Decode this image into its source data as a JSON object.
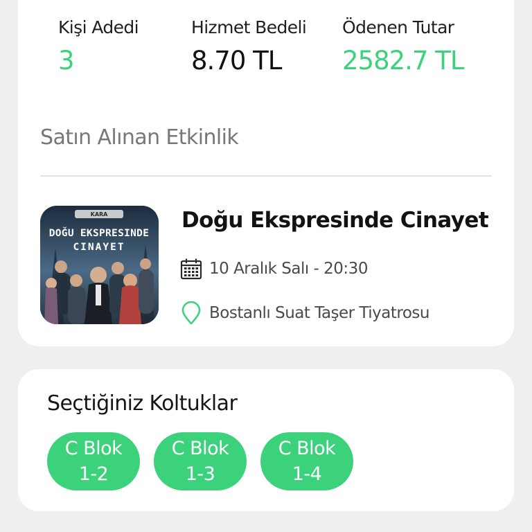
{
  "summary": {
    "people_label": "Kişi Adedi",
    "people_value": "3",
    "service_label": "Hizmet Bedeli",
    "service_value": "8.70 TL",
    "paid_label": "Ödenen Tutar",
    "paid_value": "2582.7 TL"
  },
  "event_section": {
    "title": "Satın Alınan Etkinlik",
    "event_title": "Doğu Ekspresinde Cinayet",
    "date": "10 Aralık Salı - 20:30",
    "venue": "Bostanlı Suat Taşer Tiyatrosu",
    "poster": {
      "logo_text": "KARA",
      "line1": "DOĞU EKSPRESINDE",
      "line2": "CINAYET"
    },
    "icons": {
      "date": "calendar-icon",
      "venue": "location-pin-icon"
    }
  },
  "seats": {
    "title": "Seçtiğiniz Koltuklar",
    "items": [
      {
        "block": "C Blok",
        "seat": "1-2"
      },
      {
        "block": "C Blok",
        "seat": "1-3"
      },
      {
        "block": "C Blok",
        "seat": "1-4"
      }
    ]
  },
  "colors": {
    "accent": "#3cd27c",
    "background": "#efefef",
    "card": "#ffffff"
  }
}
